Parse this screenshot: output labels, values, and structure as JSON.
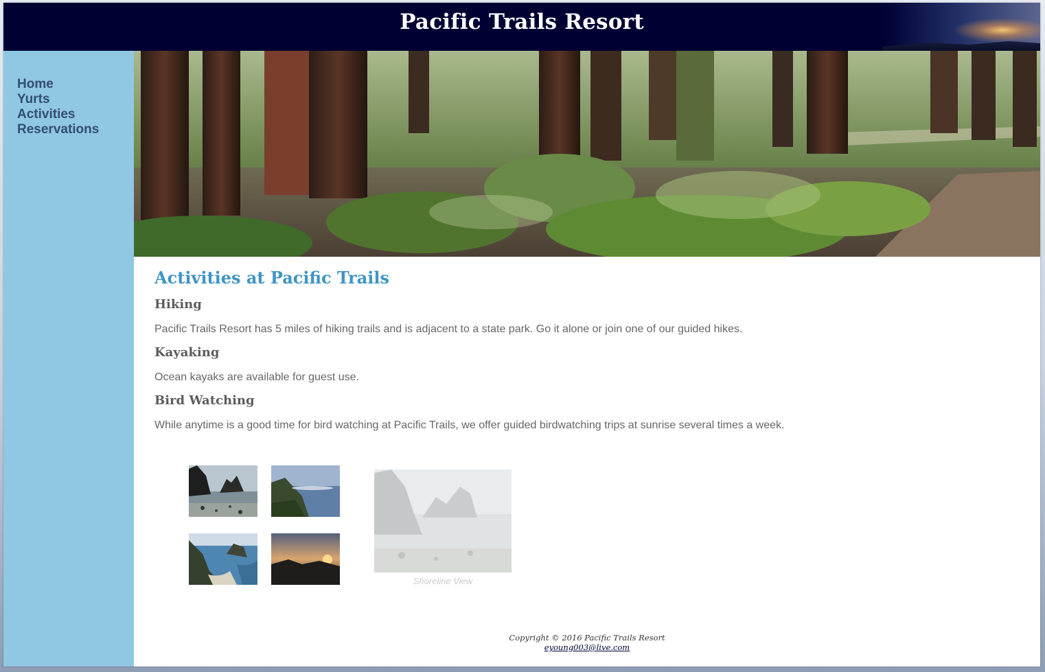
{
  "site": {
    "title": "Pacific Trails Resort"
  },
  "nav": {
    "items": [
      {
        "label": "Home"
      },
      {
        "label": "Yurts"
      },
      {
        "label": "Activities"
      },
      {
        "label": "Reservations"
      }
    ]
  },
  "hero": {
    "icon": "redwood-forest-image"
  },
  "content": {
    "heading": "Activities at Pacific Trails",
    "sections": [
      {
        "title": "Hiking",
        "text": "Pacific Trails Resort has 5 miles of hiking trails and is adjacent to a state park. Go it alone or join one of our guided hikes."
      },
      {
        "title": "Kayaking",
        "text": "Ocean kayaks are available for guest use."
      },
      {
        "title": "Bird Watching",
        "text": "While anytime is a good time for bird watching at Pacific Trails, we offer guided birdwatching trips at sunrise several times a week."
      }
    ]
  },
  "gallery": {
    "thumbnails": [
      {
        "icon": "shoreline-photo"
      },
      {
        "icon": "coast-photo"
      },
      {
        "icon": "cove-photo"
      },
      {
        "icon": "sunset-photo"
      }
    ],
    "preview_caption": "Shoreline View"
  },
  "footer": {
    "copyright": "Copyright © 2016 Pacific Trails Resort",
    "email": "eyoung003@live.com"
  },
  "colors": {
    "header_bg": "#000033",
    "nav_bg": "#90c7e3",
    "nav_text": "#324e6f",
    "heading": "#3f94c4",
    "subheading": "#5c5c5c",
    "body_text": "#666666"
  }
}
